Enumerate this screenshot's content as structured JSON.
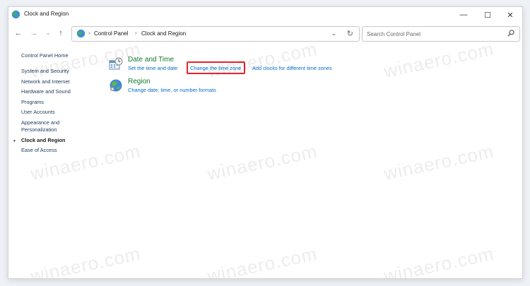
{
  "window": {
    "title": "Clock and Region",
    "controls": {
      "minimize": "—",
      "maximize": "☐",
      "close": "✕"
    }
  },
  "nav": {
    "back": "←",
    "forward": "→",
    "recent": "⌄",
    "up": "↑"
  },
  "address": {
    "crumbs": [
      "Control Panel",
      "Clock and Region"
    ],
    "separator": "›",
    "dropdown": "⌄",
    "refresh": "↻"
  },
  "search": {
    "placeholder": "Search Control Panel"
  },
  "sidebar": {
    "home": "Control Panel Home",
    "items": [
      "System and Security",
      "Network and Internet",
      "Hardware and Sound",
      "Programs",
      "User Accounts",
      "Appearance and",
      "Personalization",
      "Clock and Region",
      "Ease of Access"
    ],
    "current_index": 7,
    "bullet": "•"
  },
  "categories": {
    "datetime": {
      "title": "Date and Time",
      "links": [
        "Set the time and date",
        "Change the time zone",
        "Add clocks for different time zones"
      ]
    },
    "region": {
      "title": "Region",
      "links": [
        "Change date, time, or number formats"
      ]
    }
  },
  "watermark": "winaero.com",
  "colors": {
    "link": "#0a6acb",
    "category_title": "#137a2d",
    "highlight_box": "#e8232b"
  }
}
